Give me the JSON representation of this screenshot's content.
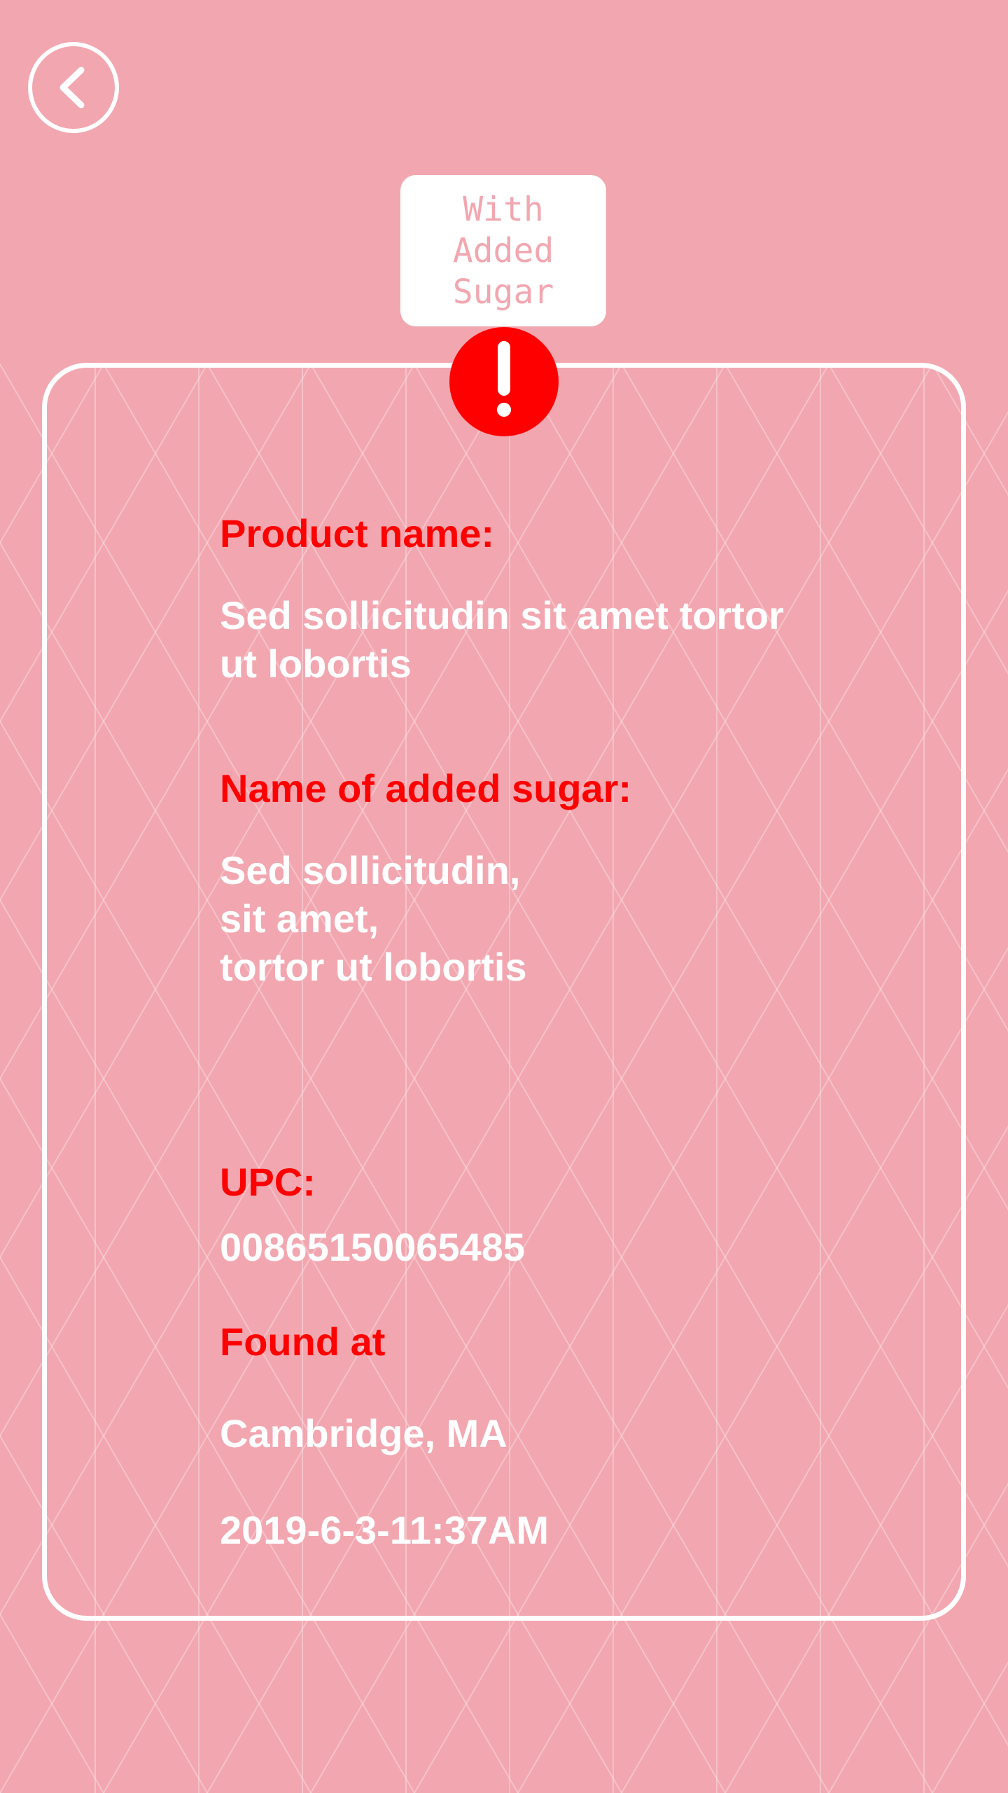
{
  "header": {
    "back_icon": "chevron-left-icon",
    "tag_label": "With\nAdded\nSugar"
  },
  "alert": {
    "icon": "exclamation-icon",
    "color": "#ff0000"
  },
  "product": {
    "name_label": "Product name:",
    "name_value": "Sed sollicitudin sit amet tortor\nut lobortis",
    "sugar_label": "Name of added sugar:",
    "sugar_value": "Sed sollicitudin,\nsit amet,\ntortor ut lobortis",
    "upc_label": "UPC:",
    "upc_value": "00865150065485",
    "found_label": "Found at",
    "location_value": "Cambridge, MA",
    "timestamp_value": "2019-6-3-11:37AM"
  },
  "colors": {
    "background": "#f2a7b0",
    "accent": "#ff0000",
    "text": "#ffffff"
  }
}
